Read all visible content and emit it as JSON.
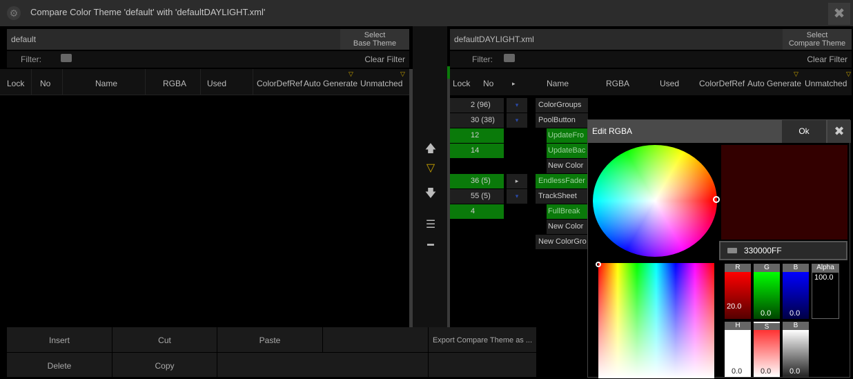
{
  "window": {
    "title": "Compare Color Theme 'default' with 'defaultDAYLIGHT.xml'",
    "gear_icon": "gear-icon",
    "close_icon": "close-icon"
  },
  "left": {
    "theme_name": "default",
    "select_button": "Select\nBase Theme",
    "filter_label": "Filter:",
    "clear_filter": "Clear Filter",
    "columns": [
      "Lock",
      "No",
      "Name",
      "RGBA",
      "Used",
      "ColorDefRef",
      "Auto Generate",
      "Unmatched"
    ]
  },
  "right": {
    "theme_name": "defaultDAYLIGHT.xml",
    "select_button": "Select\nCompare Theme",
    "filter_label": "Filter:",
    "clear_filter": "Clear Filter",
    "columns": [
      "Lock",
      "No",
      "▸",
      "Name",
      "RGBA",
      "Used",
      "ColorDefRef",
      "Auto Generate",
      "Unmatched"
    ],
    "rows": [
      {
        "no": "2 (96)",
        "expander": "▾",
        "name": "ColorGroups",
        "green": false
      },
      {
        "no": "30 (38)",
        "expander": "▾",
        "name": "PoolButton",
        "green": false
      },
      {
        "no": "12",
        "expander": "",
        "name": "UpdateFro",
        "green": true
      },
      {
        "no": "14",
        "expander": "",
        "name": "UpdateBac",
        "green": true
      },
      {
        "no": "",
        "expander": "",
        "name": "New Color",
        "green": false
      },
      {
        "no": "36 (5)",
        "expander": "▸",
        "name": "EndlessFader",
        "green": true
      },
      {
        "no": "55 (5)",
        "expander": "▾",
        "name": "TrackSheet",
        "green": false
      },
      {
        "no": "4",
        "expander": "",
        "name": "FullBreak",
        "green": true
      },
      {
        "no": "",
        "expander": "",
        "name": "New Color",
        "green": false
      },
      {
        "no": "",
        "expander": "",
        "name": "New ColorGro",
        "green": false
      }
    ]
  },
  "bottom": {
    "insert": "Insert",
    "cut": "Cut",
    "paste": "Paste",
    "export": "Export Compare Theme as ...",
    "delete": "Delete",
    "copy": "Copy"
  },
  "dialog": {
    "title": "Edit RGBA",
    "ok": "Ok",
    "hex_value": "330000FF",
    "swatch_color": "#330000",
    "rgb_labels": [
      "R",
      "G",
      "B",
      "Alpha"
    ],
    "r_value": "20.0",
    "g_value": "0.0",
    "b_value": "0.0",
    "alpha_value": "100.0",
    "hsb_labels": [
      "H",
      "S",
      "B"
    ],
    "h_value": "0.0",
    "s_value": "0.0",
    "b2_value": "0.0"
  },
  "colors": {
    "green_row": "#0a7a0a",
    "accent": "#c8a200"
  }
}
